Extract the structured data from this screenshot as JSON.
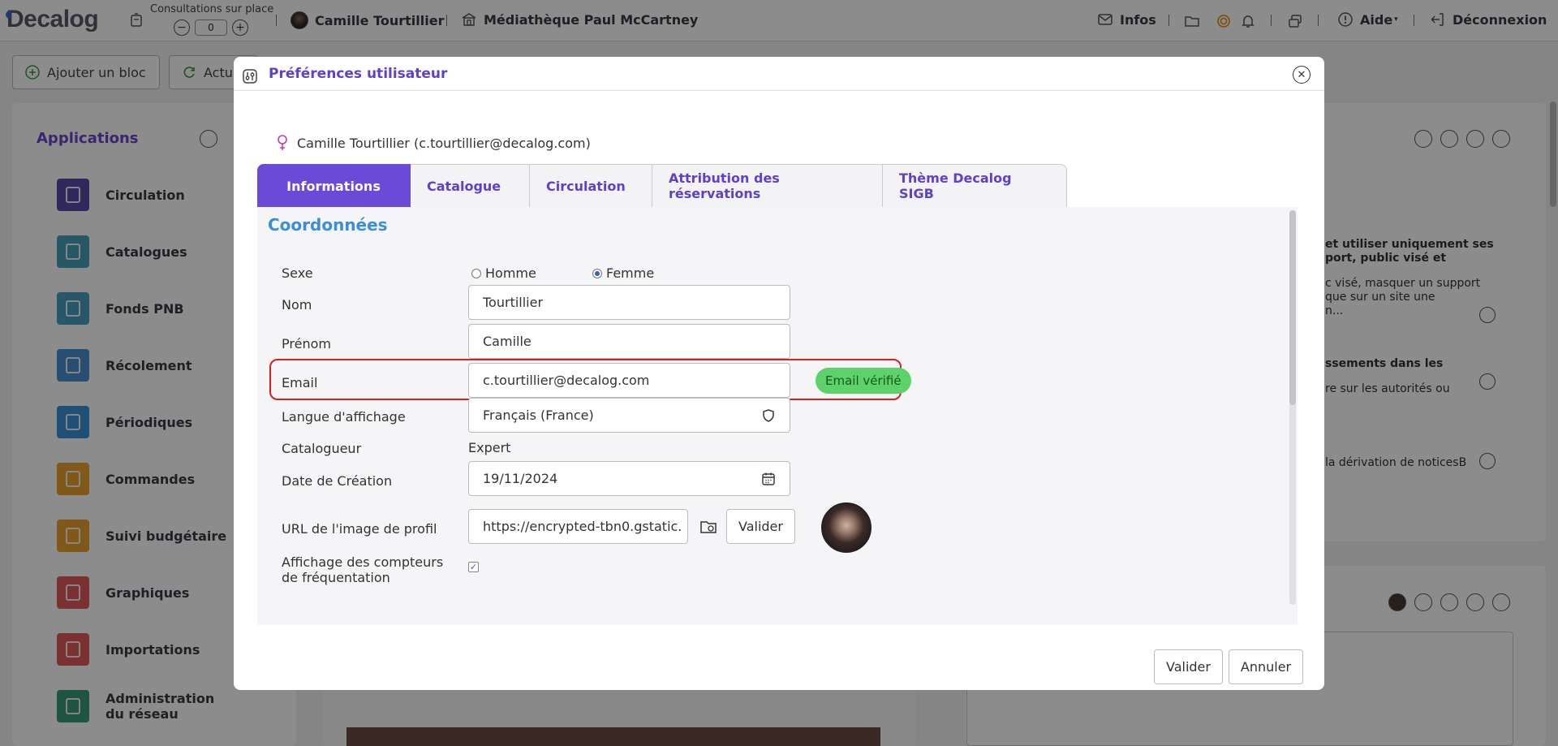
{
  "topbar": {
    "logo": "Decalog",
    "consultations_label": "Consultations sur place",
    "consultations_minus": "−",
    "consultations_value": "0",
    "consultations_plus": "+",
    "user_name": "Camille Tourtillier",
    "library_name": "Médiathèque Paul McCartney",
    "infos_label": "Infos",
    "aide_label": "Aide",
    "logout_label": "Déconnexion"
  },
  "toolbar": {
    "add_block_label": "Ajouter un bloc",
    "refresh_label": "Actu"
  },
  "applications": {
    "title": "Applications",
    "items": [
      {
        "label": "Circulation",
        "color": "#5b4aa8"
      },
      {
        "label": "Catalogues",
        "color": "#4aa0b8"
      },
      {
        "label": "Fonds PNB",
        "color": "#4a9ec0"
      },
      {
        "label": "Récolement",
        "color": "#4a8fd0"
      },
      {
        "label": "Périodiques",
        "color": "#3a8ed8"
      },
      {
        "label": "Commandes",
        "color": "#e8a030"
      },
      {
        "label": "Suivi budgétaire",
        "color": "#e8a030"
      },
      {
        "label": "Graphiques",
        "color": "#e05a5a"
      },
      {
        "label": "Importations",
        "color": "#e05a5a"
      },
      {
        "label": "Administration du réseau",
        "color": "#3a9a78"
      }
    ]
  },
  "background_right": {
    "line1": "et utiliser uniquement ses",
    "line2": "port, public visé et",
    "line3": "c visé, masquer un support",
    "line4": "que sur un site une",
    "line5": "n...",
    "line6": "ssements dans les",
    "line7": "re sur les autorités ou",
    "line8": "la dérivation de noticesB"
  },
  "modal": {
    "title": "Préférences utilisateur",
    "user_line": "Camille Tourtillier (c.tourtillier@decalog.com)",
    "tabs": [
      "Informations",
      "Catalogue",
      "Circulation",
      "Attribution des réservations",
      "Thème Decalog SIGB"
    ],
    "section_title": "Coordonnées",
    "form": {
      "sexe_label": "Sexe",
      "sexe_options": [
        "Homme",
        "Femme"
      ],
      "sexe_selected": "Femme",
      "nom_label": "Nom",
      "nom_value": "Tourtillier",
      "prenom_label": "Prénom",
      "prenom_value": "Camille",
      "email_label": "Email",
      "email_value": "c.tourtillier@decalog.com",
      "email_badge": "Email vérifié",
      "langue_label": "Langue d'affichage",
      "langue_value": "Français (France)",
      "catalogueur_label": "Catalogueur",
      "catalogueur_value": "Expert",
      "date_label": "Date de Création",
      "date_value": "19/11/2024",
      "url_label": "URL de l'image de profil",
      "url_value": "https://encrypted-tbn0.gstatic.",
      "url_validate": "Valider",
      "compteurs_label": "Affichage des compteurs de fréquentation",
      "compteurs_checked": true
    },
    "footer": {
      "validate_label": "Valider",
      "cancel_label": "Annuler"
    },
    "colors": {
      "accent": "#6a4ad6",
      "section": "#3a8fd8",
      "badge": "#5ed26a",
      "highlight": "#d62020"
    }
  }
}
